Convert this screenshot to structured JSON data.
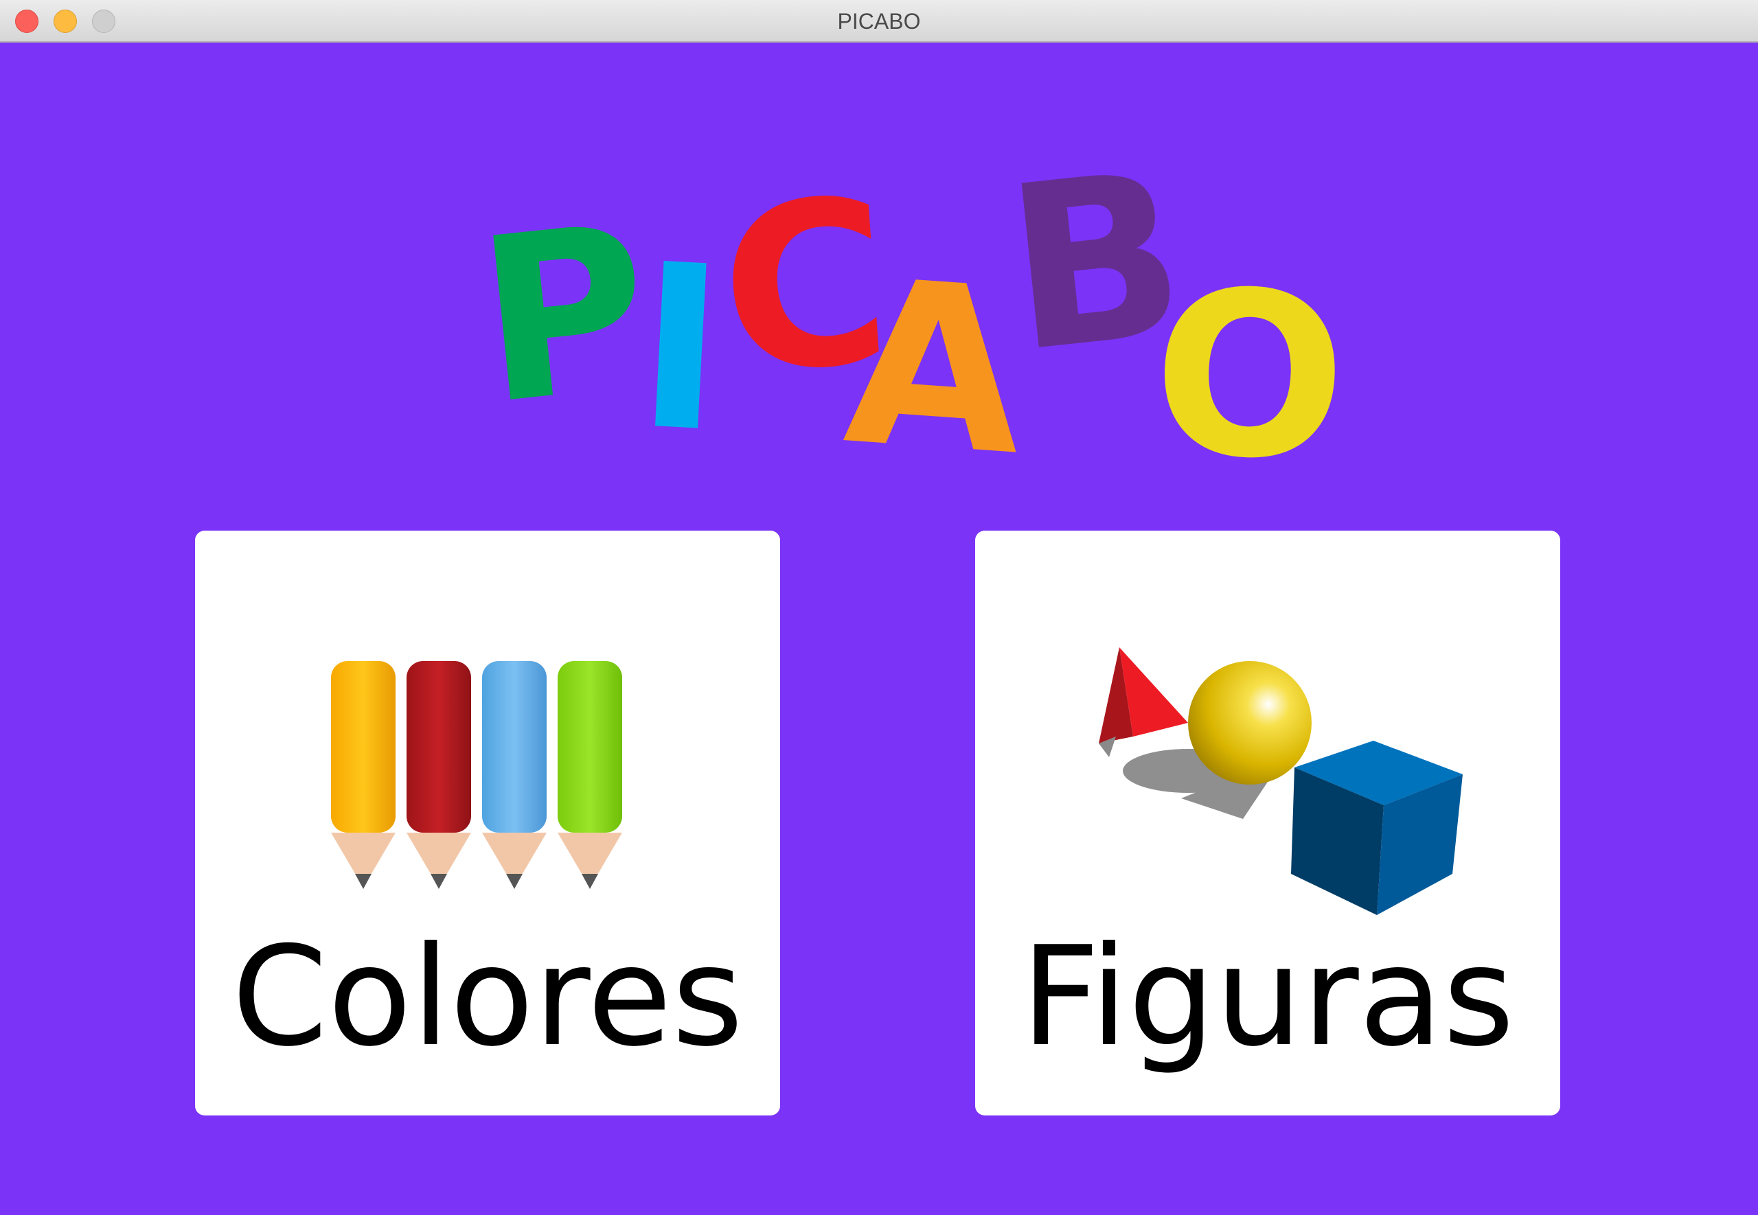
{
  "window": {
    "title": "PICABO"
  },
  "logo": {
    "letters": [
      {
        "char": "P",
        "color": "#00a651"
      },
      {
        "char": "I",
        "color": "#00aeef"
      },
      {
        "char": "C",
        "color": "#ed1c24"
      },
      {
        "char": "A",
        "color": "#f7941d"
      },
      {
        "char": "B",
        "color": "#662d91"
      },
      {
        "char": "O",
        "color": "#edd81c"
      }
    ]
  },
  "menu": {
    "colores_label": "Colores",
    "figuras_label": "Figuras"
  },
  "colors": {
    "background": "#7b33f7",
    "card": "#ffffff"
  },
  "icons": {
    "colores": "colored-pencils-icon",
    "figuras": "geometric-shapes-icon"
  }
}
